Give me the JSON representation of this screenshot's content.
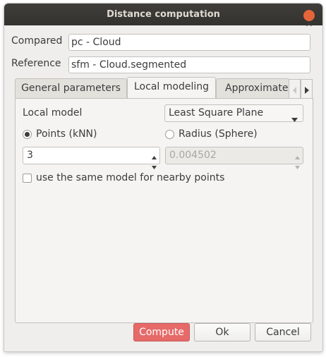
{
  "window": {
    "title": "Distance computation"
  },
  "fields": {
    "compared_label": "Compared",
    "compared_value": "pc - Cloud",
    "reference_label": "Reference",
    "reference_value": "sfm - Cloud.segmented"
  },
  "tabs": [
    {
      "label": "General parameters",
      "active": false
    },
    {
      "label": "Local modeling",
      "active": true
    },
    {
      "label": "Approximate",
      "active": false
    }
  ],
  "local_modeling": {
    "local_model_label": "Local model",
    "local_model_value": "Least Square Plane",
    "radio_points_label": "Points (kNN)",
    "radio_points_checked": true,
    "radio_radius_label": "Radius (Sphere)",
    "radio_radius_checked": false,
    "points_value": "3",
    "radius_value": "0.004502",
    "radius_enabled": false,
    "same_model_label": "use the same model for nearby points",
    "same_model_checked": false
  },
  "buttons": {
    "compute": "Compute",
    "ok": "Ok",
    "cancel": "Cancel"
  },
  "icons": {
    "close": "close-icon",
    "dropdown": "chevron-down-icon",
    "tab_left": "tab-scroll-left-icon",
    "tab_right": "tab-scroll-right-icon",
    "spin_up": "spin-up-icon",
    "spin_down": "spin-down-icon"
  },
  "colors": {
    "titlebar": "#3a3935",
    "close": "#e5643a",
    "primary_button": "#e66a68",
    "window_bg": "#efeeec"
  }
}
